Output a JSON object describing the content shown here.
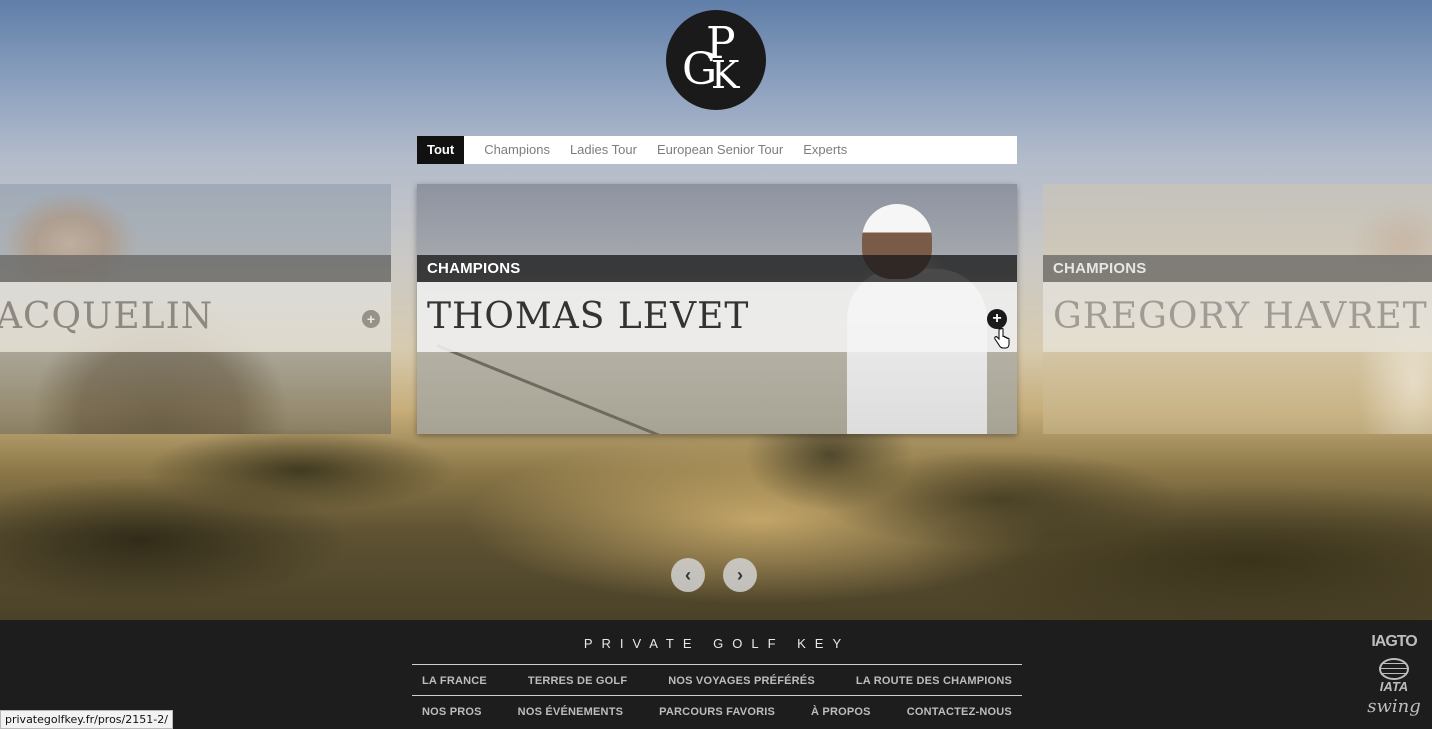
{
  "logo": {
    "letters": [
      "G",
      "P",
      "K"
    ]
  },
  "filters": [
    {
      "label": "Tout",
      "active": true
    },
    {
      "label": "Champions"
    },
    {
      "label": "Ladies Tour"
    },
    {
      "label": "European Senior Tour"
    },
    {
      "label": "Experts"
    }
  ],
  "cards": {
    "left": {
      "name": "ACQUELIN",
      "plus": "+"
    },
    "center": {
      "category": "CHAMPIONS",
      "name": "THOMAS LEVET",
      "plus": "+"
    },
    "right": {
      "category": "CHAMPIONS",
      "name": "GREGORY HAVRET"
    }
  },
  "carousel": {
    "prev": "‹",
    "next": "›"
  },
  "footer": {
    "title": "PRIVATE GOLF KEY",
    "row1": [
      "LA FRANCE",
      "TERRES DE GOLF",
      "NOS VOYAGES PRÉFÉRÉS",
      "LA ROUTE DES CHAMPIONS"
    ],
    "row2": [
      "NOS PROS",
      "NOS ÉVÉNEMENTS",
      "PARCOURS FAVORIS",
      "À PROPOS",
      "CONTACTEZ-NOUS"
    ],
    "badges": {
      "iagto": "IAGTO",
      "iata": "IATA",
      "swing": "swing"
    }
  },
  "status_url": "privategolfkey.fr/pros/2151-2/",
  "colors": {
    "dark": "#1b1a1a",
    "footer_bg": "#1d1d1d",
    "active_tab": "#111111"
  },
  "icons": {
    "plus": "plus-circle-icon",
    "prev": "chevron-left-icon",
    "next": "chevron-right-icon"
  }
}
